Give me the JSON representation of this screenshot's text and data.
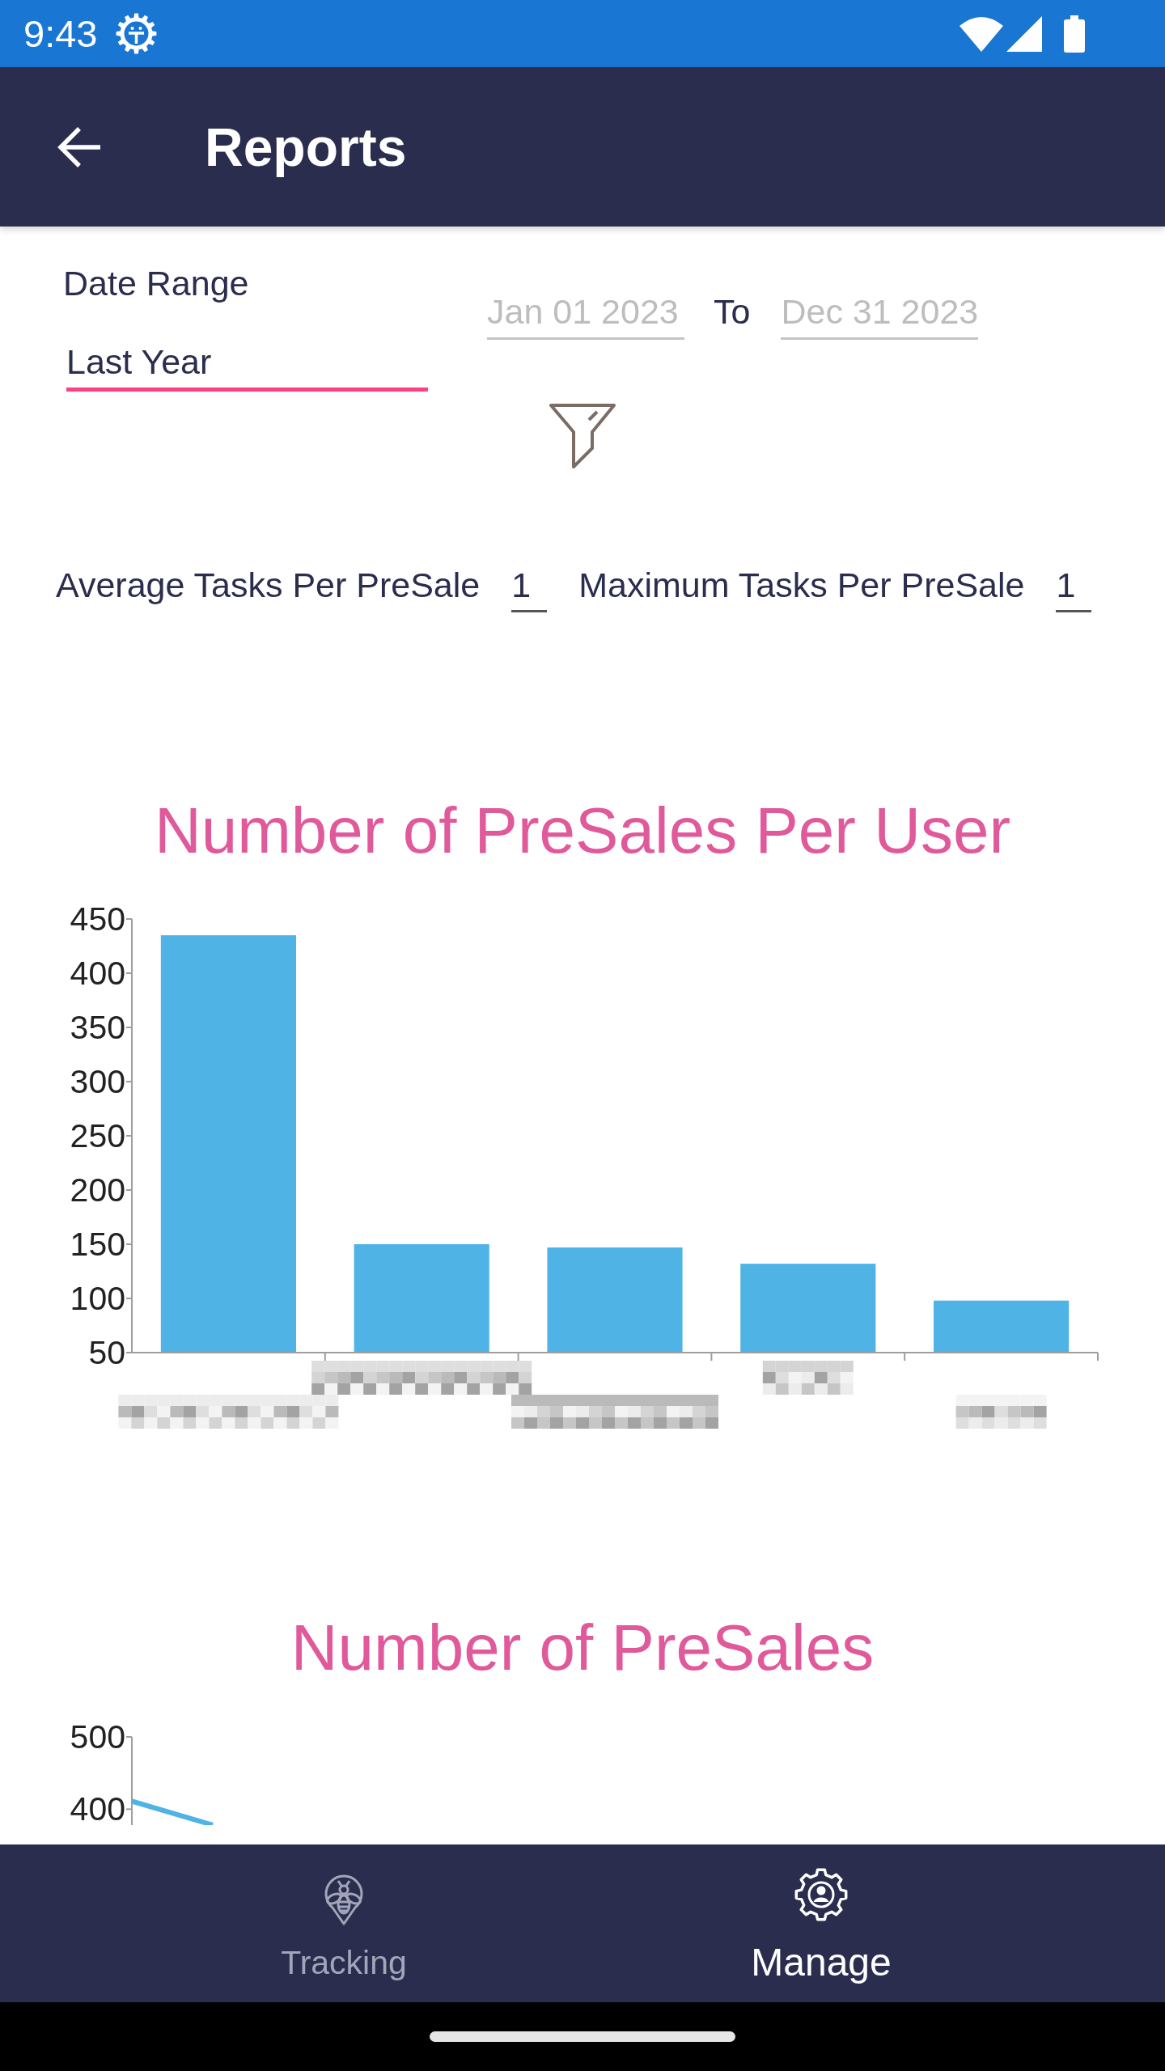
{
  "status_bar": {
    "time": "9:43"
  },
  "app_bar": {
    "title": "Reports"
  },
  "filters": {
    "date_range": {
      "label": "Date Range",
      "value": "Last Year",
      "focused": true
    },
    "start_date": {
      "value": "Jan 01 2023",
      "disabled": true
    },
    "separator": "To",
    "end_date": {
      "value": "Dec 31 2023",
      "disabled": true
    }
  },
  "stats": [
    {
      "label": "Average Tasks Per PreSale",
      "value": "1"
    },
    {
      "label": "Maximum Tasks Per PreSale",
      "value": "1"
    }
  ],
  "charts": [
    {
      "chart_data": {
        "type": "bar",
        "title": "Number of PreSales Per User",
        "categories": [
          null,
          null,
          null,
          null,
          null
        ],
        "ylim": [
          50,
          450
        ],
        "yticks": [
          50,
          100,
          150,
          200,
          250,
          300,
          350,
          400,
          450
        ],
        "values": [
          435,
          150,
          147,
          132,
          98
        ]
      }
    },
    {
      "title": "Number of PreSales",
      "y_axis_labels": [
        "500",
        "400"
      ]
    }
  ],
  "bottom_nav": [
    {
      "label": "Tracking",
      "kind": "tracking",
      "selected": false
    },
    {
      "label": "Manage",
      "kind": "manage",
      "selected": true
    }
  ]
}
